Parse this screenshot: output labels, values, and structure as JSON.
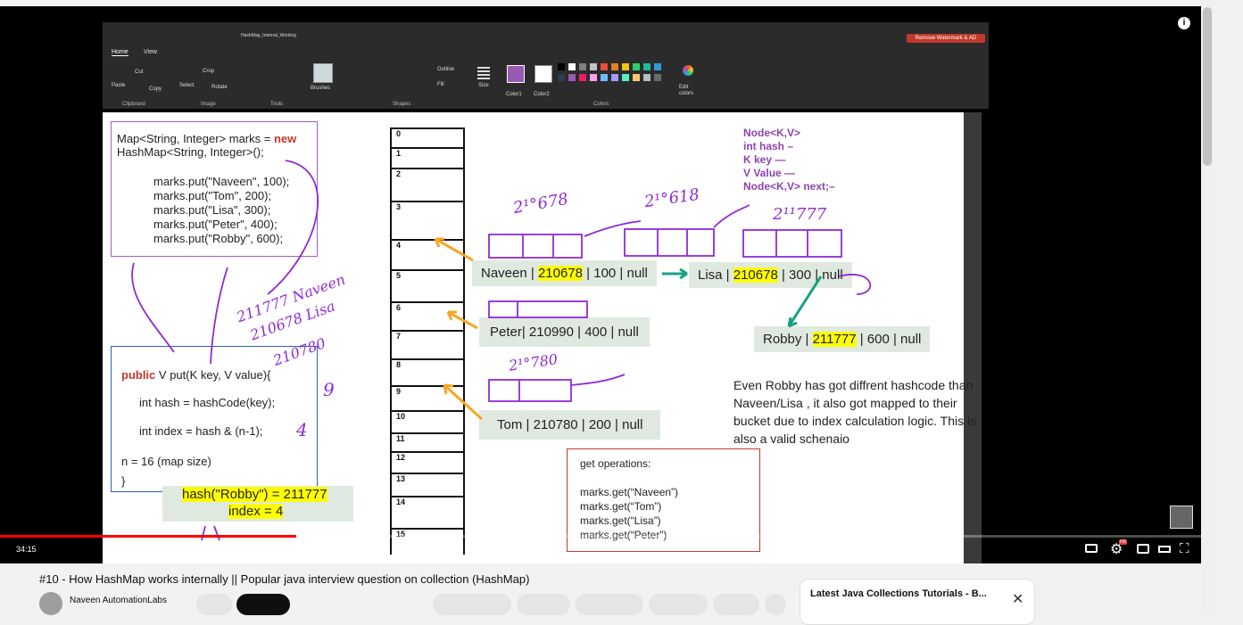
{
  "paint": {
    "doc_title": "HashMap_Internal_Working",
    "tabs": [
      "Home",
      "View"
    ],
    "tools": {
      "cut": "Cut",
      "copy": "Copy",
      "paste": "Paste",
      "select": "Select",
      "crop": "Crop",
      "rotate": "Rotate",
      "brushes": "Brushes",
      "outline": "Outline",
      "fill": "Fill",
      "size": "Size",
      "color1": "Color1",
      "color2": "Color2",
      "edit_colors": "Edit colors"
    },
    "groups": [
      "Clipboard",
      "Image",
      "Tools",
      "Shapes",
      "Colors"
    ],
    "watermark_button": "Remove Watermark & AD",
    "palette": [
      "#000000",
      "#ffffff",
      "#7f7f7f",
      "#c3c3c3",
      "#e74c3c",
      "#e67e22",
      "#f1c40f",
      "#2ecc71",
      "#1abc9c",
      "#3498db",
      "#2c3e50",
      "#9b59b6",
      "#e91e63",
      "#ff9ff3",
      "#74b9ff",
      "#a29bfe",
      "#55efc4",
      "#fdcb6e",
      "#b2bec3",
      "#636e72"
    ],
    "accent_color1": "#9b59b6"
  },
  "slide": {
    "map_decl_1": "Map<String, Integer> marks = ",
    "map_decl_new": "new",
    "map_decl_2": "HashMap<String, Integer>();",
    "puts": [
      "marks.put(\"Naveen\", 100);",
      "marks.put(\"Tom\", 200);",
      "marks.put(\"Lisa\", 300);",
      "marks.put(\"Peter\", 400);",
      "marks.put(\"Robby\", 600);"
    ],
    "method_sig_kw": "public",
    "method_sig": "V put(K key, V value){",
    "method_lines": [
      "int hash = hashCode(key);",
      "int index = hash & (n-1);",
      "n = 16 (map size)",
      "}"
    ],
    "hash_note_1": "hash(\"Robby\") = 211777",
    "hash_note_2": "index = 4",
    "buckets": [
      "0",
      "1",
      "2",
      "3",
      "4",
      "5",
      "6",
      "7",
      "8",
      "9",
      "10",
      "11",
      "12",
      "13",
      "14",
      "15"
    ],
    "node_struct": [
      "Node<K,V>",
      "int hash  –",
      "K key  —",
      "V Value  —",
      "Node<K,V> next;–"
    ],
    "nodes": {
      "naveen": {
        "pre": "Naveen | ",
        "hash": "210678",
        "post": " | 100 | null"
      },
      "lisa": {
        "pre": "Lisa | ",
        "hash": "210678",
        "post": " | 300 | null"
      },
      "robby": {
        "pre": "Robby | ",
        "hash": "211777",
        "post": " | 600 | null"
      },
      "peter": "Peter| 210990 | 400 | null",
      "tom": "Tom | 210780 | 200 | null"
    },
    "explanation": "Even Robby has got diffrent hashcode than Naveen/Lisa , it also got mapped to their bucket due to index calculation logic. This is also a valid schenaio",
    "get_ops_title": "get operations:",
    "get_ops": [
      "marks.get(“Naveen”)",
      "marks.get(“Tom”)",
      "marks.get(“Lisa”)",
      "marks.get(“Peter”)"
    ],
    "handwriting": [
      "2¹°678",
      "2¹°618",
      "2¹¹777",
      "2¹°780",
      "211777 Naveen",
      "210678 Lisa",
      "210780",
      "9",
      "4"
    ]
  },
  "player": {
    "time": "34:15",
    "progress_percent": 24.7,
    "settings_badge": "HD"
  },
  "video": {
    "title": "#10 - How HashMap works internally || Popular java interview question on collection (HashMap)",
    "channel": "Naveen AutomationLabs",
    "playlist_title": "Latest Java Collections Tutorials - B..."
  }
}
